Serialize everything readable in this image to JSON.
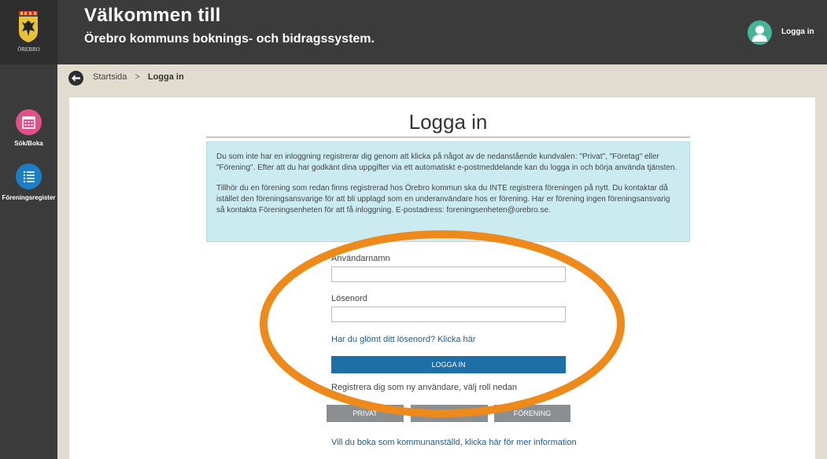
{
  "header": {
    "logo_text": "ÖREBRO",
    "title_line1": "Välkommen till",
    "title_line2": "Örebro kommuns boknings- och bidragssystem.",
    "login_label": "Logga in",
    "avatar_icon": "user-icon",
    "accent_color": "#45b59a"
  },
  "sidebar": {
    "items": [
      {
        "label": "Sök/Boka",
        "icon": "calendar-icon",
        "color": "#e0508a"
      },
      {
        "label": "Föreningsregister",
        "icon": "list-icon",
        "color": "#1c7ec4"
      }
    ]
  },
  "breadcrumb": {
    "back_icon": "arrow-left-icon",
    "home": "Startsida",
    "separator": ">",
    "current": "Logga in"
  },
  "main": {
    "title": "Logga in",
    "info_paragraphs": [
      "Du som inte har en inloggning registrerar dig genom att klicka på något av de nedanstående kundvalen: \"Privat\", \"Företag\" eller \"Förening\". Efter att du har godkänt dina uppgifter via ett automatiskt e-postmeddelande kan du logga in och börja använda tjänsten.",
      "Tillhör du en förening som redan finns registrerad hos Örebro kommun ska du INTE registrera föreningen på nytt. Du kontaktar då istället den föreningsansvarige för att bli upplagd som en underanvändare hos er förening. Har er förening ingen föreningsansvarig så kontakta Föreningsenheten för att få inloggning. E-postadress: foreningsenheten@orebro.se."
    ],
    "username_label": "Användarnamn",
    "username_value": "",
    "password_label": "Lösenord",
    "password_value": "",
    "forgot_link": "Har du glömt ditt lösenord? Klicka här",
    "login_button": "LOGGA IN",
    "register_text": "Registrera dig som ny användare, välj roll nedan",
    "roles": [
      "PRIVAT",
      "FÖRETAG",
      "FÖRENING"
    ],
    "staff_link": "Vill du boka som kommunanställd, klicka här för mer information"
  },
  "colors": {
    "dark_chrome": "#3b3b3b",
    "beige_band": "#e2dccf",
    "info_bg": "#ccebf0",
    "primary_button": "#1e6ea8",
    "role_button": "#8c8f91",
    "link": "#1d5c8f",
    "highlight_ring": "#ee8a1c"
  }
}
